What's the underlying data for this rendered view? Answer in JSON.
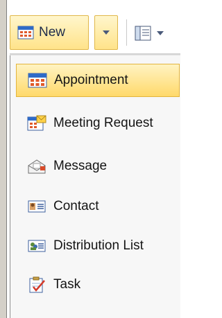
{
  "toolbar": {
    "new_label": "New",
    "new_icon": "calendar-icon",
    "split_icon": "chevron-down-icon",
    "view_icon": "reading-pane-icon"
  },
  "menu": {
    "items": [
      {
        "label": "Appointment",
        "icon": "calendar-icon",
        "selected": true
      },
      {
        "label": "Meeting Request",
        "icon": "meeting-request-icon",
        "selected": false
      },
      {
        "label": "Message",
        "icon": "envelope-icon",
        "selected": false
      },
      {
        "label": "Contact",
        "icon": "contact-card-icon",
        "selected": false
      },
      {
        "label": "Distribution List",
        "icon": "distribution-list-icon",
        "selected": false
      },
      {
        "label": "Task",
        "icon": "task-clipboard-icon",
        "selected": false
      }
    ]
  },
  "colors": {
    "highlight_top": "#fff3c2",
    "highlight_bottom": "#ffd96b",
    "highlight_border": "#e3b43d",
    "calendar_header": "#2f6bc8"
  }
}
